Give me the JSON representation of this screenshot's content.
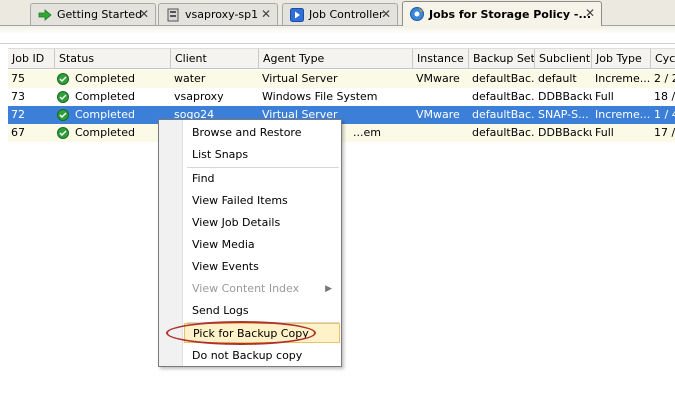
{
  "tabs": [
    {
      "label": "Getting Started",
      "icon": "green-arrow-icon"
    },
    {
      "label": "vsaproxy-sp1",
      "icon": "server-icon"
    },
    {
      "label": "Job Controller",
      "icon": "play-icon"
    },
    {
      "label": "Jobs for Storage Policy -...",
      "icon": "storage-policy-icon",
      "active": true
    }
  ],
  "close_glyph": "✕",
  "table": {
    "columns": [
      "Job ID",
      "Status",
      "Client",
      "Agent Type",
      "Instance",
      "Backup Set",
      "Subclient",
      "Job Type",
      "Cyc"
    ],
    "rows": [
      {
        "job_id": "75",
        "status": "Completed",
        "client": "water",
        "agent_type": "Virtual Server",
        "instance": "VMware",
        "backup_set": "defaultBac...",
        "subclient": "default",
        "job_type": "Increme...",
        "cycle": "2 / 2"
      },
      {
        "job_id": "73",
        "status": "Completed",
        "client": "vsaproxy",
        "agent_type": "Windows File System",
        "instance": "",
        "backup_set": "defaultBac...",
        "subclient": "DDBBackup",
        "job_type": "Full",
        "cycle": "18 /"
      },
      {
        "job_id": "72",
        "status": "Completed",
        "client": "sogo24",
        "agent_type": "Virtual Server",
        "instance": "VMware",
        "backup_set": "defaultBac...",
        "subclient": "SNAP-S...",
        "job_type": "Increme...",
        "cycle": "1 / 4",
        "selected": true
      },
      {
        "job_id": "67",
        "status": "Completed",
        "client": "",
        "agent_type": "...em",
        "instance": "",
        "backup_set": "defaultBac...",
        "subclient": "DDBBackup",
        "job_type": "Full",
        "cycle": "17 /"
      }
    ]
  },
  "context_menu": {
    "items": [
      {
        "label": "Browse and Restore"
      },
      {
        "label": "List Snaps"
      },
      {
        "label": "Find"
      },
      {
        "label": "View Failed Items"
      },
      {
        "label": "View Job Details"
      },
      {
        "label": "View Media"
      },
      {
        "label": "View Events"
      },
      {
        "label": "View Content Index",
        "disabled": true,
        "submenu": true
      },
      {
        "label": "Send Logs"
      },
      {
        "label": "Pick for Backup Copy",
        "highlighted": true
      },
      {
        "label": "Do not Backup copy"
      }
    ],
    "submenu_glyph": "▶"
  },
  "colors": {
    "selection": "#3c7fd8",
    "row_alt": "#fbfae6",
    "highlight_circle": "#b0322b",
    "status_ok": "#2f9e3a"
  }
}
